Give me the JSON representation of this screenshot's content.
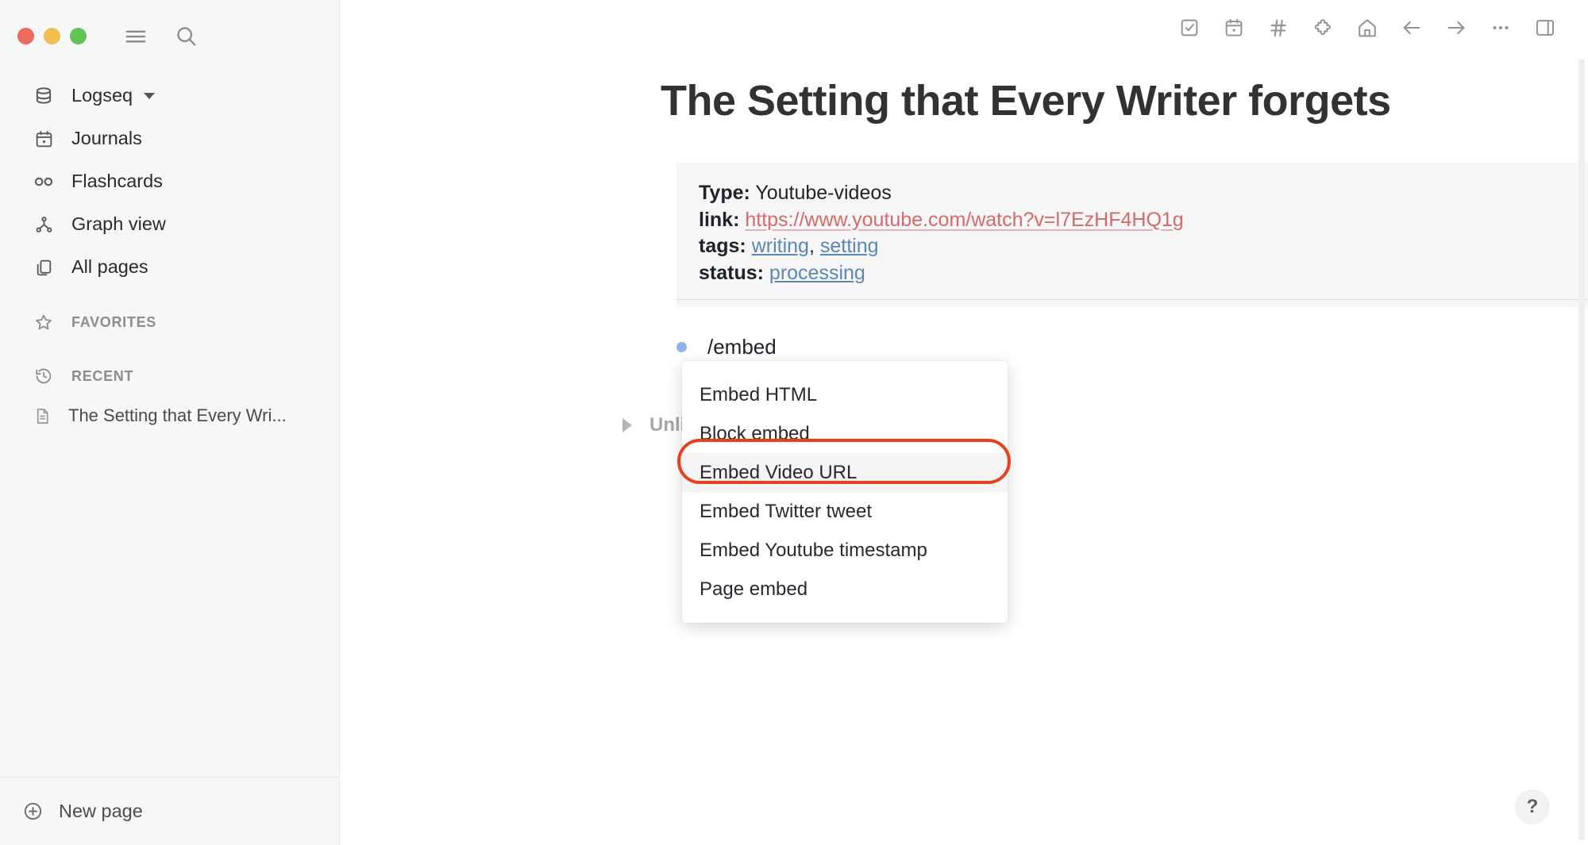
{
  "window": {
    "traffic_lights": [
      "close-red",
      "minimize-yellow",
      "maximize-green"
    ],
    "colors": {
      "close": "#ec6a5f",
      "minimize": "#f1bf4f",
      "maximize": "#61c454",
      "sidebar_bg": "#f7f7f7",
      "accent_annotation": "#e8401c",
      "link_red": "#d46a6a",
      "tag_blue": "#5b87b5",
      "active_bullet_blue": "#8fb4e8"
    }
  },
  "sidebar": {
    "top_icons": [
      {
        "name": "menu-icon",
        "label": "Toggle left sidebar"
      },
      {
        "name": "search-icon",
        "label": "Search"
      }
    ],
    "graph_selector": {
      "label": "Logseq",
      "icon": "database-icon",
      "caret": "chevron-down-icon"
    },
    "items": [
      {
        "label": "Journals",
        "icon": "calendar-icon"
      },
      {
        "label": "Flashcards",
        "icon": "infinity-icon"
      },
      {
        "label": "Graph view",
        "icon": "graph-icon"
      },
      {
        "label": "All pages",
        "icon": "pages-icon"
      }
    ],
    "favorites": {
      "label": "FAVORITES",
      "icon": "star-icon"
    },
    "recent": {
      "label": "RECENT",
      "icon": "clock-history-icon"
    },
    "recent_items": [
      {
        "label": "The Setting that Every Wri...",
        "icon": "page-icon"
      }
    ],
    "footer": {
      "new_page_label": "New page",
      "icon": "plus-circle-icon"
    }
  },
  "toolbar": {
    "buttons": [
      {
        "name": "todo-icon",
        "label": "Tasks"
      },
      {
        "name": "calendar-icon",
        "label": "Journals"
      },
      {
        "name": "hashtag-icon",
        "label": "Tags"
      },
      {
        "name": "puzzle-icon",
        "label": "Plugins"
      },
      {
        "name": "home-icon",
        "label": "Home"
      },
      {
        "name": "arrow-left-icon",
        "label": "Back"
      },
      {
        "name": "arrow-right-icon",
        "label": "Forward"
      },
      {
        "name": "ellipsis-icon",
        "label": "More"
      },
      {
        "name": "right-sidebar-icon",
        "label": "Toggle right sidebar"
      }
    ]
  },
  "page": {
    "title": "The Setting that Every Writer forgets",
    "properties": [
      {
        "key": "Type:",
        "value": "Youtube-videos",
        "kind": "text"
      },
      {
        "key": "link:",
        "value": "https://www.youtube.com/watch?v=l7EzHF4HQ1g",
        "kind": "link"
      },
      {
        "key": "tags:",
        "value": "writing, setting",
        "kind": "tags",
        "tags": [
          "writing",
          "setting"
        ],
        "separator": ", "
      },
      {
        "key": "status:",
        "value": "processing",
        "kind": "tag"
      }
    ],
    "blocks": [
      {
        "text": "/embed",
        "bullet": "active"
      }
    ],
    "collapsed_section": {
      "label": "Unli",
      "toggle": "triangle-right-icon"
    }
  },
  "command_menu": {
    "items": [
      {
        "label": "Embed HTML",
        "selected": false
      },
      {
        "label": "Block embed",
        "selected": false
      },
      {
        "label": "Embed Video URL",
        "selected": true
      },
      {
        "label": "Embed Twitter tweet",
        "selected": false
      },
      {
        "label": "Embed Youtube timestamp",
        "selected": false
      },
      {
        "label": "Page embed",
        "selected": false
      }
    ]
  },
  "help": {
    "label": "?"
  }
}
